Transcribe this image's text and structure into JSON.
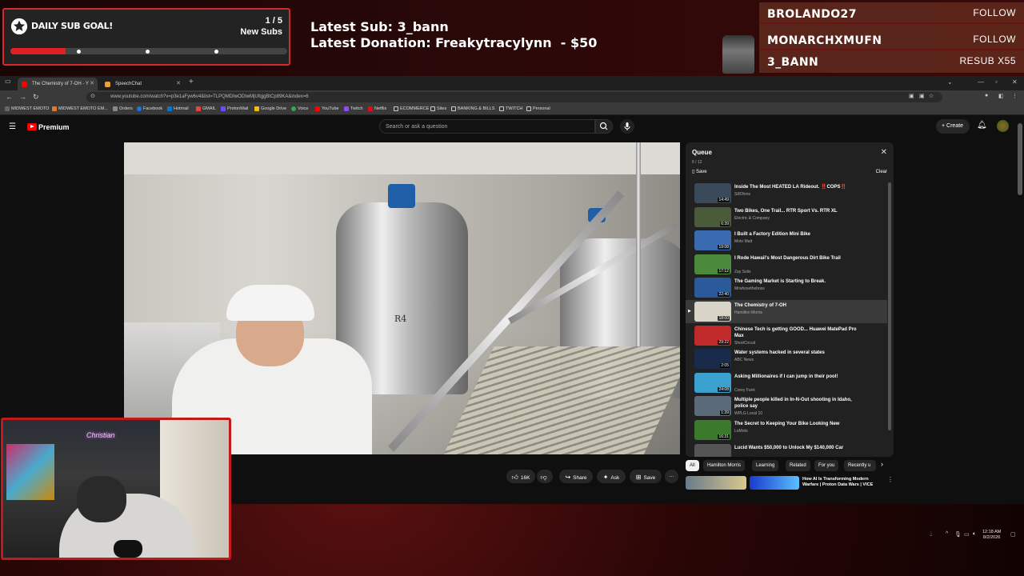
{
  "overlay": {
    "goal": {
      "title": "DAILY SUB GOAL!",
      "count": "1 / 5",
      "label": "New Subs",
      "progress": 0.2
    },
    "latest_sub": "Latest Sub: 3_bann",
    "latest_donation": "Latest Donation: Freakytracylynn  - $50",
    "events": [
      {
        "name": "BROLANDO27",
        "kind": "FOLLOW"
      },
      {
        "name": "MONARCHXMUFN",
        "kind": "FOLLOW"
      },
      {
        "name": "3_BANN",
        "kind": "RESUB X55"
      }
    ]
  },
  "browser": {
    "tabs": [
      {
        "title": "The Chemistry of 7-OH - Y",
        "active": true
      },
      {
        "title": "SpeechChat",
        "active": false
      }
    ],
    "new_tab": "+",
    "url": "www.youtube.com/watch?v=p3e1aFyw6v4&list=TLPQMDIwODIwMjUfqjgBtCp89KA&index=6",
    "bookmarks": [
      "MIDWEST EMOTO",
      "MIDWEST EMOTO EM...",
      "Orders",
      "Facebook",
      "Hotmail",
      "GMAIL",
      "ProtonMail",
      "Google Drive",
      "Voice",
      "YouTube",
      "Twitch",
      "Netflix",
      "ECOMMERCE",
      "Sites",
      "BANKING & BILLS",
      "TWITCH",
      "Personal"
    ]
  },
  "youtube": {
    "brand": "Premium",
    "search_placeholder": "Search or ask a question",
    "create_label": "Create",
    "actions": {
      "like": "16K",
      "share": "Share",
      "ask": "Ask",
      "save": "Save"
    },
    "queue": {
      "title": "Queue",
      "position": "6 / 12",
      "save": "Save",
      "clear": "Clear",
      "items": [
        {
          "title": "Inside The Most HEATED LA Rideout. ‼️COPS‼️",
          "channel": "SillOhms",
          "duration": "14:49",
          "thumb": "#3a4a5a"
        },
        {
          "title": "Two Bikes, One Trail... RTR Sport Vs. RTR XL",
          "channel": "Electric & Company",
          "duration": "6:39",
          "thumb": "#4a5a3a"
        },
        {
          "title": "I Built a Factory Edition Mini Bike",
          "channel": "Moto Matt",
          "duration": "19:08",
          "thumb": "#3a6ab0"
        },
        {
          "title": "I Rode Hawaii's Most Dangerous Dirt Bike Trail",
          "channel": "Zay Solis",
          "duration": "17:12",
          "thumb": "#4a8a3a"
        },
        {
          "title": "The Gaming Market is Starting to Break.",
          "channel": "Mrwhosetheboss",
          "duration": "22:40",
          "thumb": "#2a5a9a"
        },
        {
          "title": "The Chemistry of 7-OH",
          "channel": "Hamilton Morris",
          "duration": "18:00",
          "thumb": "#d8d4c8",
          "current": true
        },
        {
          "title": "Chinese Tech is getting GOOD... Huawei MatePad Pro Max",
          "channel": "ShortCircuit",
          "duration": "29:22",
          "thumb": "#c02a2a"
        },
        {
          "title": "Water systems hacked in several states",
          "channel": "ABC News",
          "duration": "2:05",
          "thumb": "#1a2a4a"
        },
        {
          "title": "Asking Millionaires if I can jump in their pool!",
          "channel": "Corey Funk",
          "duration": "24:08",
          "thumb": "#3aa0d0"
        },
        {
          "title": "Multiple people killed in In-N-Out shooting in Idaho, police say",
          "channel": "WPLG Local 10",
          "duration": "1:39",
          "thumb": "#5a6a7a"
        },
        {
          "title": "The Secret to Keeping Your Bike Looking New",
          "channel": "LoMoto",
          "duration": "16:31",
          "thumb": "#3a7a2a"
        },
        {
          "title": "Lucid Wants $50,000 to Unlock My $140,000 Car",
          "channel": "",
          "duration": "",
          "thumb": "#555555"
        }
      ]
    },
    "chips": [
      "All",
      "Hamilton Morris",
      "Learning",
      "Related",
      "For you",
      "Recently u"
    ],
    "related_title": "How AI Is Transforming Modern Warfare | Proton Data Wars | VICE"
  },
  "tray": {
    "time": "12:18 AM",
    "date": "8/2/2026"
  },
  "webcam": {
    "neon": "Christian"
  }
}
